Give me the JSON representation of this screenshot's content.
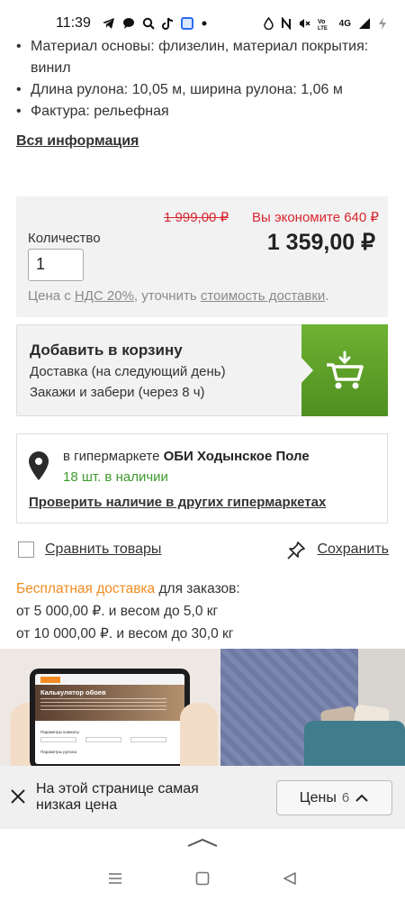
{
  "status_bar": {
    "time": "11:39",
    "left_icons": [
      "telegram-icon",
      "chat-icon",
      "search-icon",
      "tiktok-icon",
      "app-icon",
      "dot-icon"
    ],
    "right_text": "4G",
    "right_icons": [
      "drop-icon",
      "nfc-icon",
      "mute-icon",
      "volte-icon",
      "signal-icon",
      "battery-charging-icon"
    ]
  },
  "specs": [
    "Материал основы: флизелин, материал покрытия: винил",
    "Длина рулона: 10,05 м, ширина рулона: 1,06 м",
    "Фактура: рельефная"
  ],
  "all_info_link": "Вся информация",
  "price_box": {
    "old_price": "1 999,00 ₽",
    "savings": "Вы экономите 640 ₽",
    "quantity_label": "Количество",
    "quantity_value": "1",
    "price": "1 359,00 ₽",
    "vat_prefix": "Цена с ",
    "vat_link": "НДС 20%",
    "vat_middle": ", уточнить ",
    "delivery_cost_link": "стоимость доставки",
    "vat_suffix": "."
  },
  "cart_box": {
    "title": "Добавить в корзину",
    "line1": "Доставка (на следующий день)",
    "line2": "Закажи и забери (через 8 ч)",
    "button_icon": "cart-add-icon"
  },
  "store_box": {
    "prefix": "в гипермаркете ",
    "store_name": "ОБИ Ходынское Поле",
    "stock": "18 шт. в наличии",
    "check_other_link": "Проверить наличие в других гипермаркетах"
  },
  "compare_label": "Сравнить товары",
  "save_label": "Сохранить",
  "delivery": {
    "free_label": "Бесплатная доставка",
    "free_suffix": " для заказов:",
    "line1": "от 5 000,00 ₽. и весом до 5,0 кг",
    "line2": "от 10 000,00 ₽. и весом до 30,0 кг"
  },
  "banner": {
    "tablet_title": "Калькулятор обоев",
    "tablet_label1": "Параметры комнаты",
    "tablet_label2": "Параметры рулона"
  },
  "toast": {
    "text": "На этой странице самая низкая цена",
    "button_label": "Цены",
    "button_count": "6"
  },
  "colors": {
    "accent_red": "#d8262f",
    "accent_green": "#5aa02c",
    "stock_green": "#3f9a2e",
    "accent_orange": "#f28c22"
  }
}
